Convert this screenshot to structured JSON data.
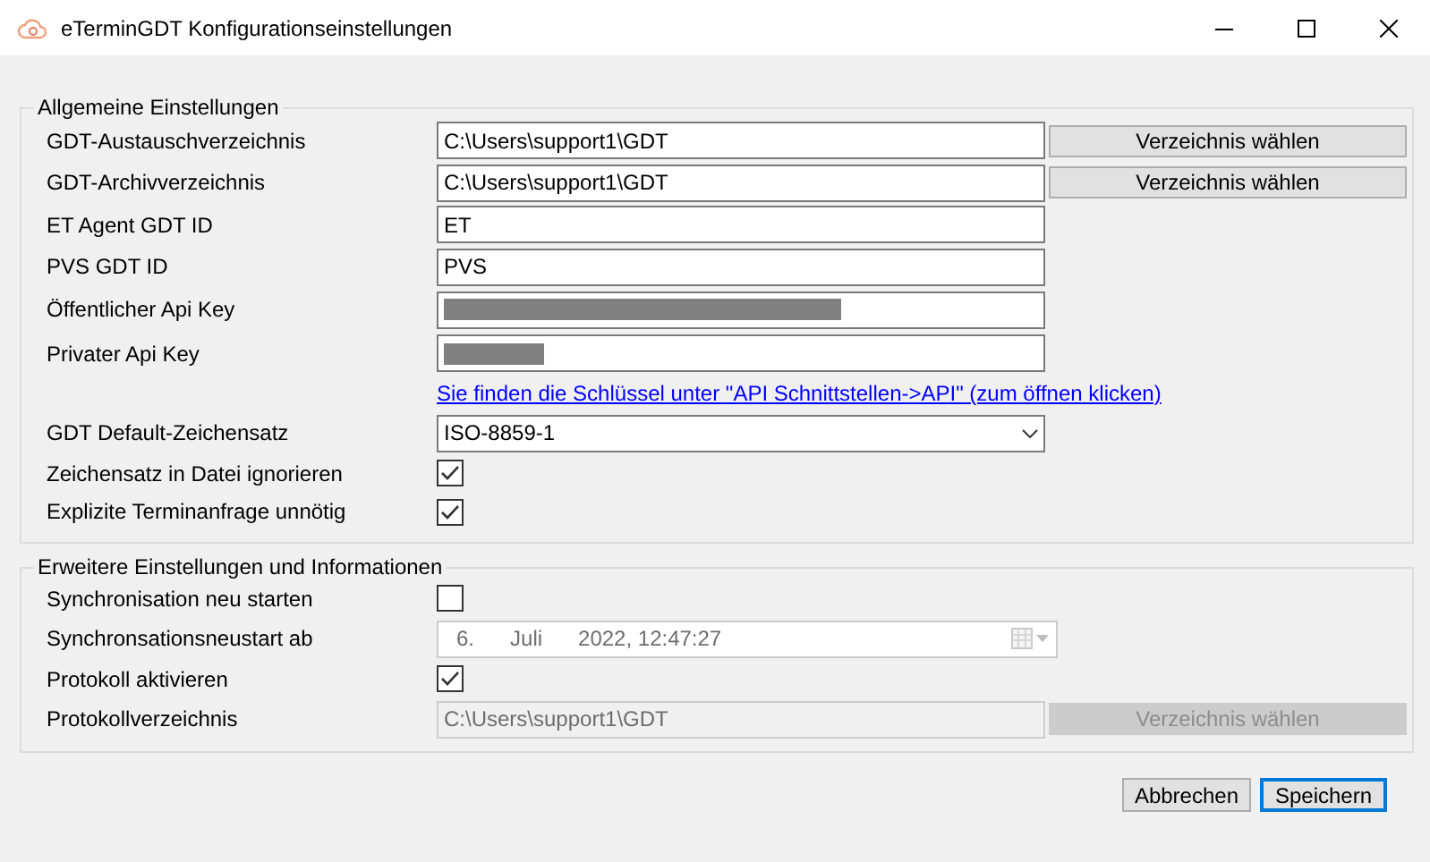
{
  "window": {
    "title": "eTerminGDT Konfigurationseinstellungen"
  },
  "groups": [
    {
      "title": "Allgemeine Einstellungen",
      "rows": [
        {
          "kind": "path",
          "label": "GDT-Austauschverzeichnis",
          "value": "C:\\Users\\support1\\GDT",
          "disabled": false,
          "button": {
            "label": "Verzeichnis wählen",
            "disabled": false
          }
        },
        {
          "kind": "path",
          "label": "GDT-Archivverzeichnis",
          "value": "C:\\Users\\support1\\GDT",
          "disabled": false,
          "button": {
            "label": "Verzeichnis wählen",
            "disabled": false
          }
        },
        {
          "kind": "text",
          "label": "ET Agent GDT ID",
          "value": "ET",
          "disabled": false
        },
        {
          "kind": "text",
          "label": "PVS GDT ID",
          "value": "PVS",
          "disabled": false
        },
        {
          "kind": "redacted",
          "label": "Öffentlicher Api Key",
          "level": 0.67
        },
        {
          "kind": "redacted",
          "label": "Privater Api Key",
          "level": 0.17
        },
        {
          "kind": "link",
          "text": "Sie finden die Schlüssel unter \"API Schnittstellen->API\" (zum öffnen klicken)"
        },
        {
          "kind": "combo",
          "label": "GDT Default-Zeichensatz",
          "value": "ISO-8859-1"
        },
        {
          "kind": "checkbox",
          "label": "Zeichensatz in Datei ignorieren",
          "checked": true
        },
        {
          "kind": "checkbox",
          "label": "Explizite Terminanfrage unnötig",
          "checked": true
        }
      ]
    },
    {
      "title": "Erweitere Einstellungen und Informationen",
      "rows": [
        {
          "kind": "checkbox",
          "label": "Synchronisation neu starten",
          "checked": false
        },
        {
          "kind": "date",
          "label": "Synchronsationsneustart ab",
          "parts": [
            "6.",
            "Juli",
            "2022, 12:47:27"
          ],
          "disabled": true
        },
        {
          "kind": "checkbox",
          "label": "Protokoll aktivieren",
          "checked": true
        },
        {
          "kind": "path",
          "label": "Protokollverzeichnis",
          "value": "C:\\Users\\support1\\GDT",
          "disabled": true,
          "button": {
            "label": "Verzeichnis wählen",
            "disabled": true
          }
        }
      ]
    }
  ],
  "buttons": [
    {
      "label": "Abbrechen",
      "default": false
    },
    {
      "label": "Speichern",
      "default": true
    }
  ]
}
